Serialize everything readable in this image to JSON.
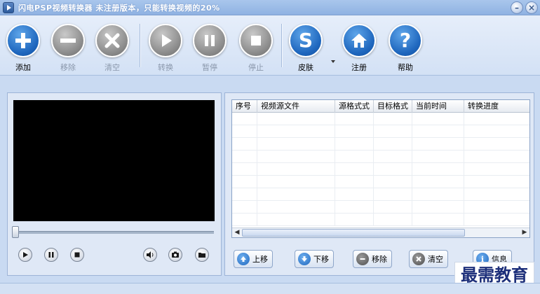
{
  "window": {
    "title": "闪电PSP视频转换器  未注册版本，只能转换视频的20%"
  },
  "toolbar": {
    "buttons": [
      {
        "label": "添加",
        "icon": "plus-icon",
        "enabled": true
      },
      {
        "label": "移除",
        "icon": "minus-icon",
        "enabled": false
      },
      {
        "label": "清空",
        "icon": "x-icon",
        "enabled": false
      },
      {
        "label": "转换",
        "icon": "play-icon",
        "enabled": false
      },
      {
        "label": "暂停",
        "icon": "pause-icon",
        "enabled": false
      },
      {
        "label": "停止",
        "icon": "stop-icon",
        "enabled": false
      },
      {
        "label": "皮肤",
        "icon": "skin-s-icon",
        "enabled": true
      },
      {
        "label": "注册",
        "icon": "home-icon",
        "enabled": true
      },
      {
        "label": "帮助",
        "icon": "question-icon",
        "enabled": true
      }
    ]
  },
  "table": {
    "columns": [
      "序号",
      "视频源文件",
      "源格式式",
      "目标格式",
      "当前时间",
      "转换进度"
    ],
    "rows": []
  },
  "actions": {
    "up": "上移",
    "down": "下移",
    "remove": "移除",
    "clear": "清空",
    "info": "信息"
  },
  "watermark": "最需教育",
  "colors": {
    "accent_blue": "#1f67be",
    "disabled_gray": "#8c8c8c",
    "background": "#c9daf2"
  }
}
